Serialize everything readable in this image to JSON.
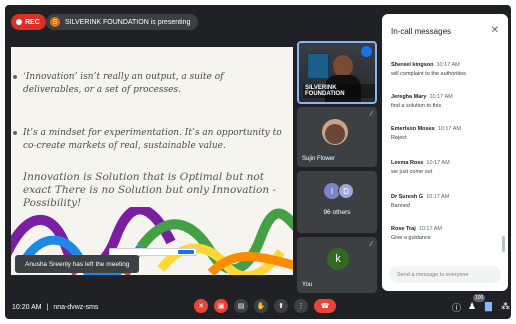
{
  "recording": {
    "label": "REC"
  },
  "presenter": {
    "text": "SILVERINK FOUNDATION is presenting"
  },
  "slide": {
    "bullet1": "‘Innovation’ isn’t really an output, a suite of deliverables, or a set of processes.",
    "bullet2": "It’s a mindset for experimentation. It’s an opportunity to co-create markets of real, sustainable value.",
    "quote": "Innovation is Solution that is Optimal but not exact There is no Solution but only Innovation - Possibility!"
  },
  "toast": {
    "text": "Anusha Sreenly has left the meeting"
  },
  "tiles": {
    "self_label": "SILVERINK FOUNDATION",
    "sujin_name": "Sujin Flower",
    "others": {
      "initial1": "I",
      "initial2": "D",
      "count_text": "96 others"
    },
    "you": {
      "initial": "k",
      "name": "You"
    }
  },
  "chat": {
    "title": "In-call messages",
    "input_placeholder": "Send a message to everyone",
    "messages": [
      {
        "sender": "Shereel kingson",
        "time": "10:17 AM",
        "text": "will complaint to the authorities"
      },
      {
        "sender": "Jeregha Mary",
        "time": "10:17 AM",
        "text": "find a solution to this"
      },
      {
        "sender": "Emerlson Moses",
        "time": "10:17 AM",
        "text": "Reject"
      },
      {
        "sender": "Leema Rose",
        "time": "10:17 AM",
        "text": "we just come out"
      },
      {
        "sender": "Dr Suresh G",
        "time": "10:17 AM",
        "text": "Banned"
      },
      {
        "sender": "Rose Traj",
        "time": "10:17 AM",
        "text": "Give a guidance"
      }
    ]
  },
  "bottom": {
    "time": "10:20 AM",
    "separator": "|",
    "meeting_code": "nna-dvwz-sms",
    "participant_count": "100"
  }
}
